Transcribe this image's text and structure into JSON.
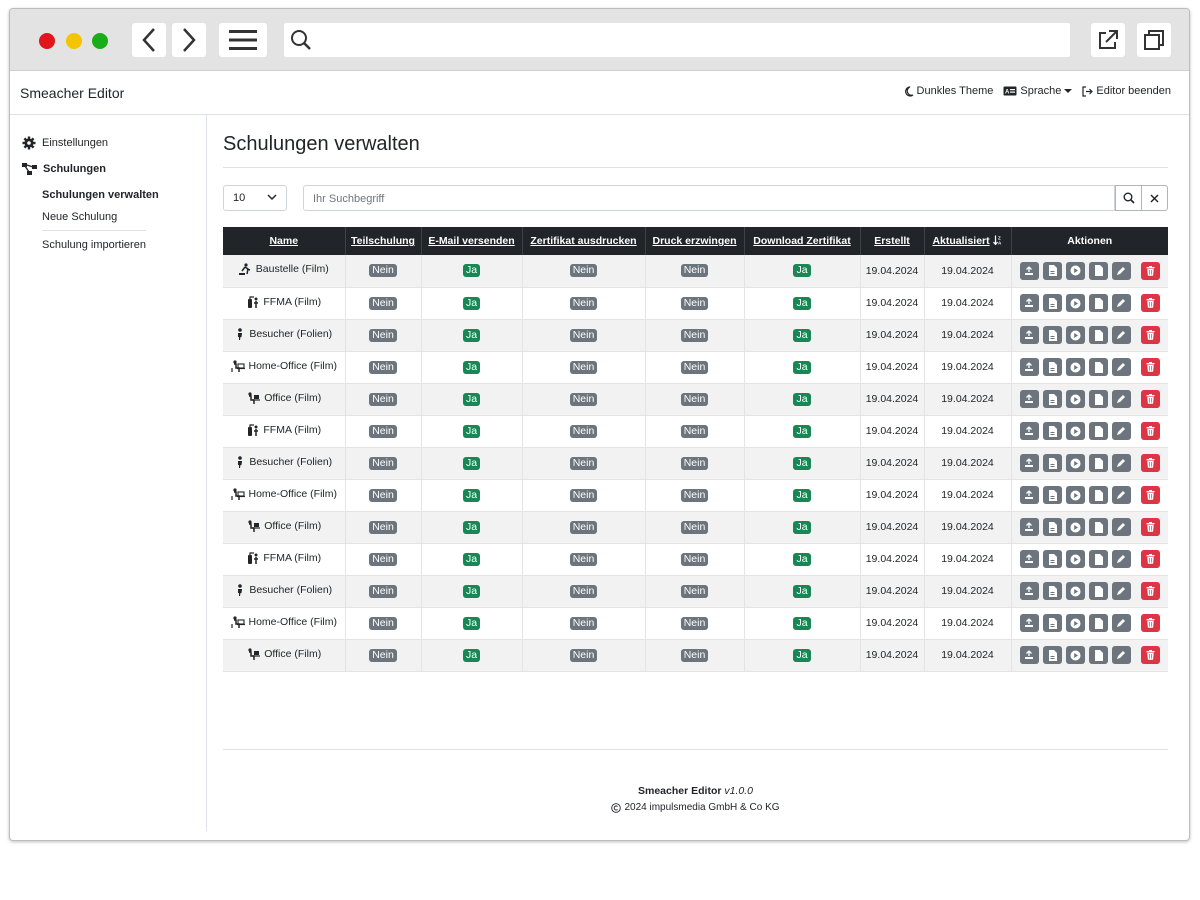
{
  "colors": {
    "close": "#e0161b",
    "minimize": "#f5c400",
    "maximize": "#1aad19",
    "dark": "#212529",
    "success": "#198754",
    "secondary": "#6c757d",
    "danger": "#dc3545"
  },
  "navbar": {
    "brand": "Smeacher Editor",
    "dark_theme": "Dunkles Theme",
    "language": "Sprache",
    "exit": "Editor beenden"
  },
  "sidebar": {
    "settings": "Einstellungen",
    "trainings": "Schulungen",
    "manage": "Schulungen verwalten",
    "new": "Neue Schulung",
    "import": "Schulung importieren"
  },
  "main": {
    "title": "Schulungen verwalten",
    "per_page": "10",
    "search_placeholder": "Ihr Suchbegriff"
  },
  "table": {
    "headers": [
      "Name",
      "Teilschulung",
      "E-Mail versenden",
      "Zertifikat ausdrucken",
      "Druck erzwingen",
      "Download Zertifikat",
      "Erstellt",
      "Aktualisiert",
      "Aktionen"
    ],
    "rows": [
      {
        "icon": "construction-icon",
        "name": "Baustelle (Film)",
        "teil": "Nein",
        "mail": "Ja",
        "zert": "Nein",
        "druck": "Nein",
        "download": "Ja",
        "created": "19.04.2024",
        "updated": "19.04.2024"
      },
      {
        "icon": "fire-extinguisher-icon",
        "name": "FFMA (Film)",
        "teil": "Nein",
        "mail": "Ja",
        "zert": "Nein",
        "druck": "Nein",
        "download": "Ja",
        "created": "19.04.2024",
        "updated": "19.04.2024"
      },
      {
        "icon": "visitor-icon",
        "name": "Besucher (Folien)",
        "teil": "Nein",
        "mail": "Ja",
        "zert": "Nein",
        "druck": "Nein",
        "download": "Ja",
        "created": "19.04.2024",
        "updated": "19.04.2024"
      },
      {
        "icon": "home-office-icon",
        "name": "Home-Office (Film)",
        "teil": "Nein",
        "mail": "Ja",
        "zert": "Nein",
        "druck": "Nein",
        "download": "Ja",
        "created": "19.04.2024",
        "updated": "19.04.2024"
      },
      {
        "icon": "office-icon",
        "name": "Office (Film)",
        "teil": "Nein",
        "mail": "Ja",
        "zert": "Nein",
        "druck": "Nein",
        "download": "Ja",
        "created": "19.04.2024",
        "updated": "19.04.2024"
      },
      {
        "icon": "fire-extinguisher-icon",
        "name": "FFMA (Film)",
        "teil": "Nein",
        "mail": "Ja",
        "zert": "Nein",
        "druck": "Nein",
        "download": "Ja",
        "created": "19.04.2024",
        "updated": "19.04.2024"
      },
      {
        "icon": "visitor-icon",
        "name": "Besucher (Folien)",
        "teil": "Nein",
        "mail": "Ja",
        "zert": "Nein",
        "druck": "Nein",
        "download": "Ja",
        "created": "19.04.2024",
        "updated": "19.04.2024"
      },
      {
        "icon": "home-office-icon",
        "name": "Home-Office (Film)",
        "teil": "Nein",
        "mail": "Ja",
        "zert": "Nein",
        "druck": "Nein",
        "download": "Ja",
        "created": "19.04.2024",
        "updated": "19.04.2024"
      },
      {
        "icon": "office-icon",
        "name": "Office (Film)",
        "teil": "Nein",
        "mail": "Ja",
        "zert": "Nein",
        "druck": "Nein",
        "download": "Ja",
        "created": "19.04.2024",
        "updated": "19.04.2024"
      },
      {
        "icon": "fire-extinguisher-icon",
        "name": "FFMA (Film)",
        "teil": "Nein",
        "mail": "Ja",
        "zert": "Nein",
        "druck": "Nein",
        "download": "Ja",
        "created": "19.04.2024",
        "updated": "19.04.2024"
      },
      {
        "icon": "visitor-icon",
        "name": "Besucher (Folien)",
        "teil": "Nein",
        "mail": "Ja",
        "zert": "Nein",
        "druck": "Nein",
        "download": "Ja",
        "created": "19.04.2024",
        "updated": "19.04.2024"
      },
      {
        "icon": "home-office-icon",
        "name": "Home-Office (Film)",
        "teil": "Nein",
        "mail": "Ja",
        "zert": "Nein",
        "druck": "Nein",
        "download": "Ja",
        "created": "19.04.2024",
        "updated": "19.04.2024"
      },
      {
        "icon": "office-icon",
        "name": "Office (Film)",
        "teil": "Nein",
        "mail": "Ja",
        "zert": "Nein",
        "druck": "Nein",
        "download": "Ja",
        "created": "19.04.2024",
        "updated": "19.04.2024"
      }
    ]
  },
  "footer": {
    "product": "Smeacher Editor",
    "version": "v1.0.0",
    "copyright": "2024 impulsmedia GmbH & Co KG"
  }
}
